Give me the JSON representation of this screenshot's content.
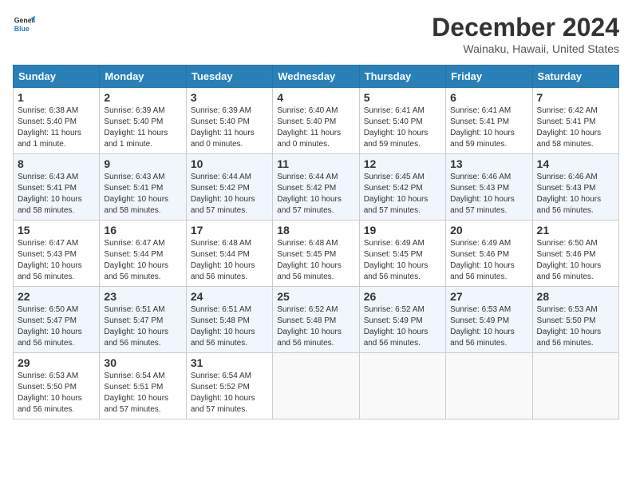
{
  "header": {
    "logo_line1": "General",
    "logo_line2": "Blue",
    "month_title": "December 2024",
    "location": "Wainaku, Hawaii, United States"
  },
  "weekdays": [
    "Sunday",
    "Monday",
    "Tuesday",
    "Wednesday",
    "Thursday",
    "Friday",
    "Saturday"
  ],
  "weeks": [
    [
      {
        "day": "1",
        "sunrise": "6:38 AM",
        "sunset": "5:40 PM",
        "daylight": "11 hours and 1 minute."
      },
      {
        "day": "2",
        "sunrise": "6:39 AM",
        "sunset": "5:40 PM",
        "daylight": "11 hours and 1 minute."
      },
      {
        "day": "3",
        "sunrise": "6:39 AM",
        "sunset": "5:40 PM",
        "daylight": "11 hours and 0 minutes."
      },
      {
        "day": "4",
        "sunrise": "6:40 AM",
        "sunset": "5:40 PM",
        "daylight": "11 hours and 0 minutes."
      },
      {
        "day": "5",
        "sunrise": "6:41 AM",
        "sunset": "5:40 PM",
        "daylight": "10 hours and 59 minutes."
      },
      {
        "day": "6",
        "sunrise": "6:41 AM",
        "sunset": "5:41 PM",
        "daylight": "10 hours and 59 minutes."
      },
      {
        "day": "7",
        "sunrise": "6:42 AM",
        "sunset": "5:41 PM",
        "daylight": "10 hours and 58 minutes."
      }
    ],
    [
      {
        "day": "8",
        "sunrise": "6:43 AM",
        "sunset": "5:41 PM",
        "daylight": "10 hours and 58 minutes."
      },
      {
        "day": "9",
        "sunrise": "6:43 AM",
        "sunset": "5:41 PM",
        "daylight": "10 hours and 58 minutes."
      },
      {
        "day": "10",
        "sunrise": "6:44 AM",
        "sunset": "5:42 PM",
        "daylight": "10 hours and 57 minutes."
      },
      {
        "day": "11",
        "sunrise": "6:44 AM",
        "sunset": "5:42 PM",
        "daylight": "10 hours and 57 minutes."
      },
      {
        "day": "12",
        "sunrise": "6:45 AM",
        "sunset": "5:42 PM",
        "daylight": "10 hours and 57 minutes."
      },
      {
        "day": "13",
        "sunrise": "6:46 AM",
        "sunset": "5:43 PM",
        "daylight": "10 hours and 57 minutes."
      },
      {
        "day": "14",
        "sunrise": "6:46 AM",
        "sunset": "5:43 PM",
        "daylight": "10 hours and 56 minutes."
      }
    ],
    [
      {
        "day": "15",
        "sunrise": "6:47 AM",
        "sunset": "5:43 PM",
        "daylight": "10 hours and 56 minutes."
      },
      {
        "day": "16",
        "sunrise": "6:47 AM",
        "sunset": "5:44 PM",
        "daylight": "10 hours and 56 minutes."
      },
      {
        "day": "17",
        "sunrise": "6:48 AM",
        "sunset": "5:44 PM",
        "daylight": "10 hours and 56 minutes."
      },
      {
        "day": "18",
        "sunrise": "6:48 AM",
        "sunset": "5:45 PM",
        "daylight": "10 hours and 56 minutes."
      },
      {
        "day": "19",
        "sunrise": "6:49 AM",
        "sunset": "5:45 PM",
        "daylight": "10 hours and 56 minutes."
      },
      {
        "day": "20",
        "sunrise": "6:49 AM",
        "sunset": "5:46 PM",
        "daylight": "10 hours and 56 minutes."
      },
      {
        "day": "21",
        "sunrise": "6:50 AM",
        "sunset": "5:46 PM",
        "daylight": "10 hours and 56 minutes."
      }
    ],
    [
      {
        "day": "22",
        "sunrise": "6:50 AM",
        "sunset": "5:47 PM",
        "daylight": "10 hours and 56 minutes."
      },
      {
        "day": "23",
        "sunrise": "6:51 AM",
        "sunset": "5:47 PM",
        "daylight": "10 hours and 56 minutes."
      },
      {
        "day": "24",
        "sunrise": "6:51 AM",
        "sunset": "5:48 PM",
        "daylight": "10 hours and 56 minutes."
      },
      {
        "day": "25",
        "sunrise": "6:52 AM",
        "sunset": "5:48 PM",
        "daylight": "10 hours and 56 minutes."
      },
      {
        "day": "26",
        "sunrise": "6:52 AM",
        "sunset": "5:49 PM",
        "daylight": "10 hours and 56 minutes."
      },
      {
        "day": "27",
        "sunrise": "6:53 AM",
        "sunset": "5:49 PM",
        "daylight": "10 hours and 56 minutes."
      },
      {
        "day": "28",
        "sunrise": "6:53 AM",
        "sunset": "5:50 PM",
        "daylight": "10 hours and 56 minutes."
      }
    ],
    [
      {
        "day": "29",
        "sunrise": "6:53 AM",
        "sunset": "5:50 PM",
        "daylight": "10 hours and 56 minutes."
      },
      {
        "day": "30",
        "sunrise": "6:54 AM",
        "sunset": "5:51 PM",
        "daylight": "10 hours and 57 minutes."
      },
      {
        "day": "31",
        "sunrise": "6:54 AM",
        "sunset": "5:52 PM",
        "daylight": "10 hours and 57 minutes."
      },
      null,
      null,
      null,
      null
    ]
  ],
  "labels": {
    "sunrise_prefix": "Sunrise: ",
    "sunset_prefix": "Sunset: ",
    "daylight_prefix": "Daylight: "
  }
}
